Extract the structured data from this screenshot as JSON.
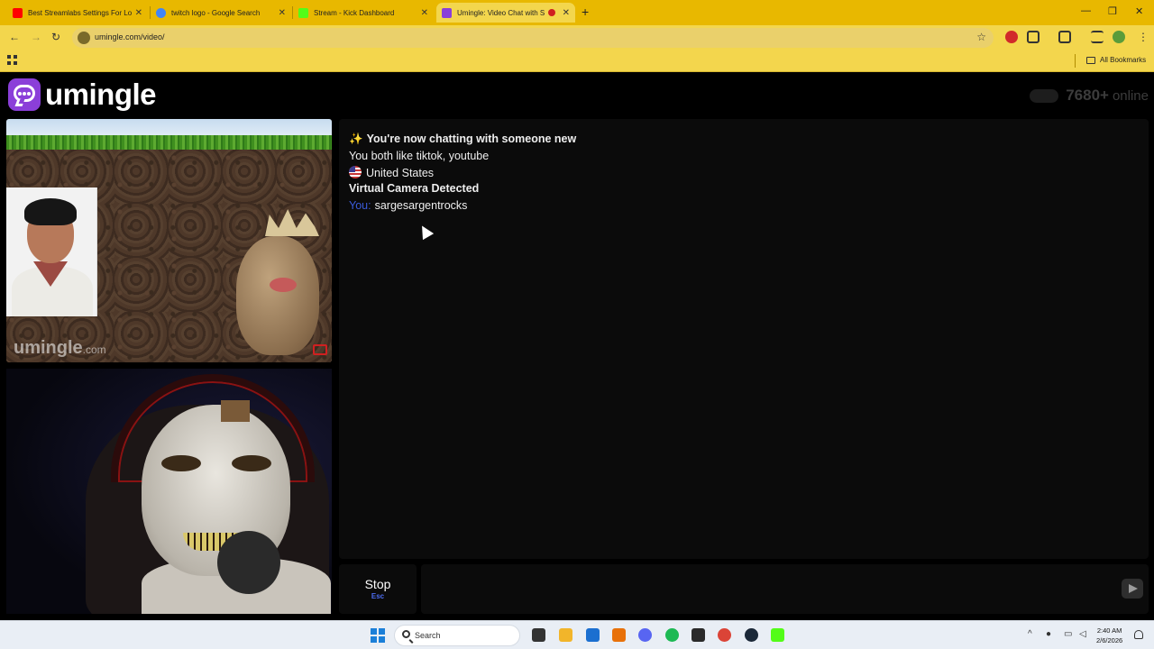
{
  "browser": {
    "tabs": [
      {
        "title": "Best Streamlabs Settings For Lo",
        "favicon_color": "#ff0000"
      },
      {
        "title": "twitch logo - Google Search",
        "favicon_color": "#4285f4"
      },
      {
        "title": "Stream - Kick Dashboard",
        "favicon_color": "#53fc18"
      },
      {
        "title": "Umingle: Video Chat with S",
        "favicon_color": "#8b3fd9"
      }
    ],
    "url": "umingle.com/video/",
    "bookmarks_all": "All Bookmarks"
  },
  "site": {
    "logo_text": "umingle",
    "online_count": "7680+",
    "online_label": "online"
  },
  "remote_video": {
    "watermark": "umingle",
    "watermark_suffix": ".com"
  },
  "chat": {
    "intro_sparkle": "✨",
    "intro": "You're now chatting with someone new",
    "interests": "You both like tiktok, youtube",
    "country": "United States",
    "camera_notice": "Virtual Camera Detected",
    "you_label": "You:",
    "you_message": "sargesargentrocks"
  },
  "controls": {
    "stop_label": "Stop",
    "stop_key": "Esc",
    "message_value": ""
  },
  "taskbar": {
    "search_label": "Search",
    "time": "2:40 AM",
    "date": "2/6/2026"
  },
  "colors": {
    "tab_strip": "#e8b800",
    "brand_purple": "#8b3fd9",
    "you_label": "#3b5bdb"
  }
}
